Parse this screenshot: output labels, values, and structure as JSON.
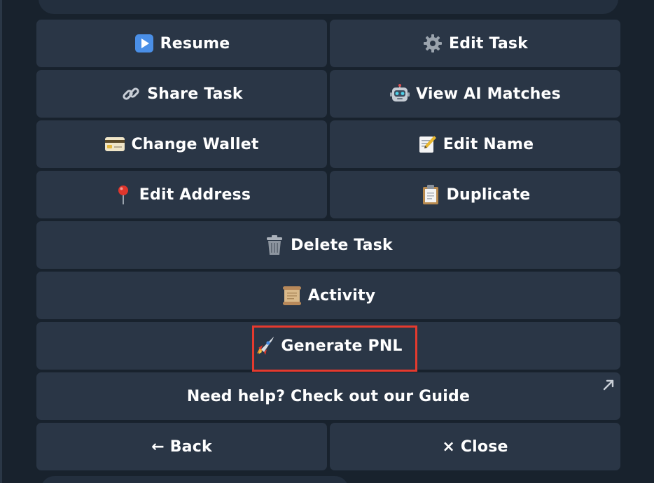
{
  "buttons": {
    "resume": "Resume",
    "edit_task": "Edit Task",
    "share_task": "Share Task",
    "view_ai_matches": "View AI Matches",
    "change_wallet": "Change Wallet",
    "edit_name": "Edit Name",
    "edit_address": "Edit Address",
    "duplicate": "Duplicate",
    "delete_task": "Delete Task",
    "activity": "Activity",
    "generate_pnl": "Generate PNL",
    "guide": "Need help? Check out our Guide",
    "back": "← Back",
    "close": "× Close"
  },
  "icons": {
    "resume": "play-button-icon",
    "edit_task": "gear-icon",
    "share_task": "link-icon",
    "view_ai_matches": "robot-icon",
    "change_wallet": "credit-card-icon",
    "edit_name": "memo-icon",
    "edit_address": "pushpin-icon",
    "duplicate": "clipboard-icon",
    "delete_task": "trash-can-icon",
    "activity": "scroll-icon",
    "generate_pnl": "rocket-icon",
    "guide": "external-link-arrow-icon"
  },
  "colors": {
    "background": "#18222d",
    "button": "#2a3646",
    "text": "#ffffff",
    "highlight": "#e53a2e"
  }
}
